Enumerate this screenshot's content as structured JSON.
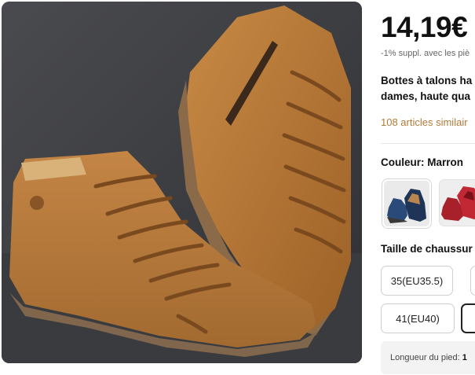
{
  "product": {
    "price": "14,19€",
    "price_note": "-1% suppl. avec les piè",
    "title_line1": "Bottes à talons ha",
    "title_line2": "dames, haute qua",
    "similar_link": "108 articles similair",
    "color_label": "Couleur:",
    "color_value": "Marron",
    "color_options": [
      {
        "name": "blue-boots",
        "color": "#2a4a7a"
      },
      {
        "name": "red-boots",
        "color": "#a8202a"
      }
    ],
    "size_label": "Taille de chaussur",
    "sizes": [
      "35(EU35.5)",
      "",
      "41(EU40)",
      "4"
    ],
    "foot_length_label": "Longueur du pied:",
    "foot_length_value": "1"
  }
}
